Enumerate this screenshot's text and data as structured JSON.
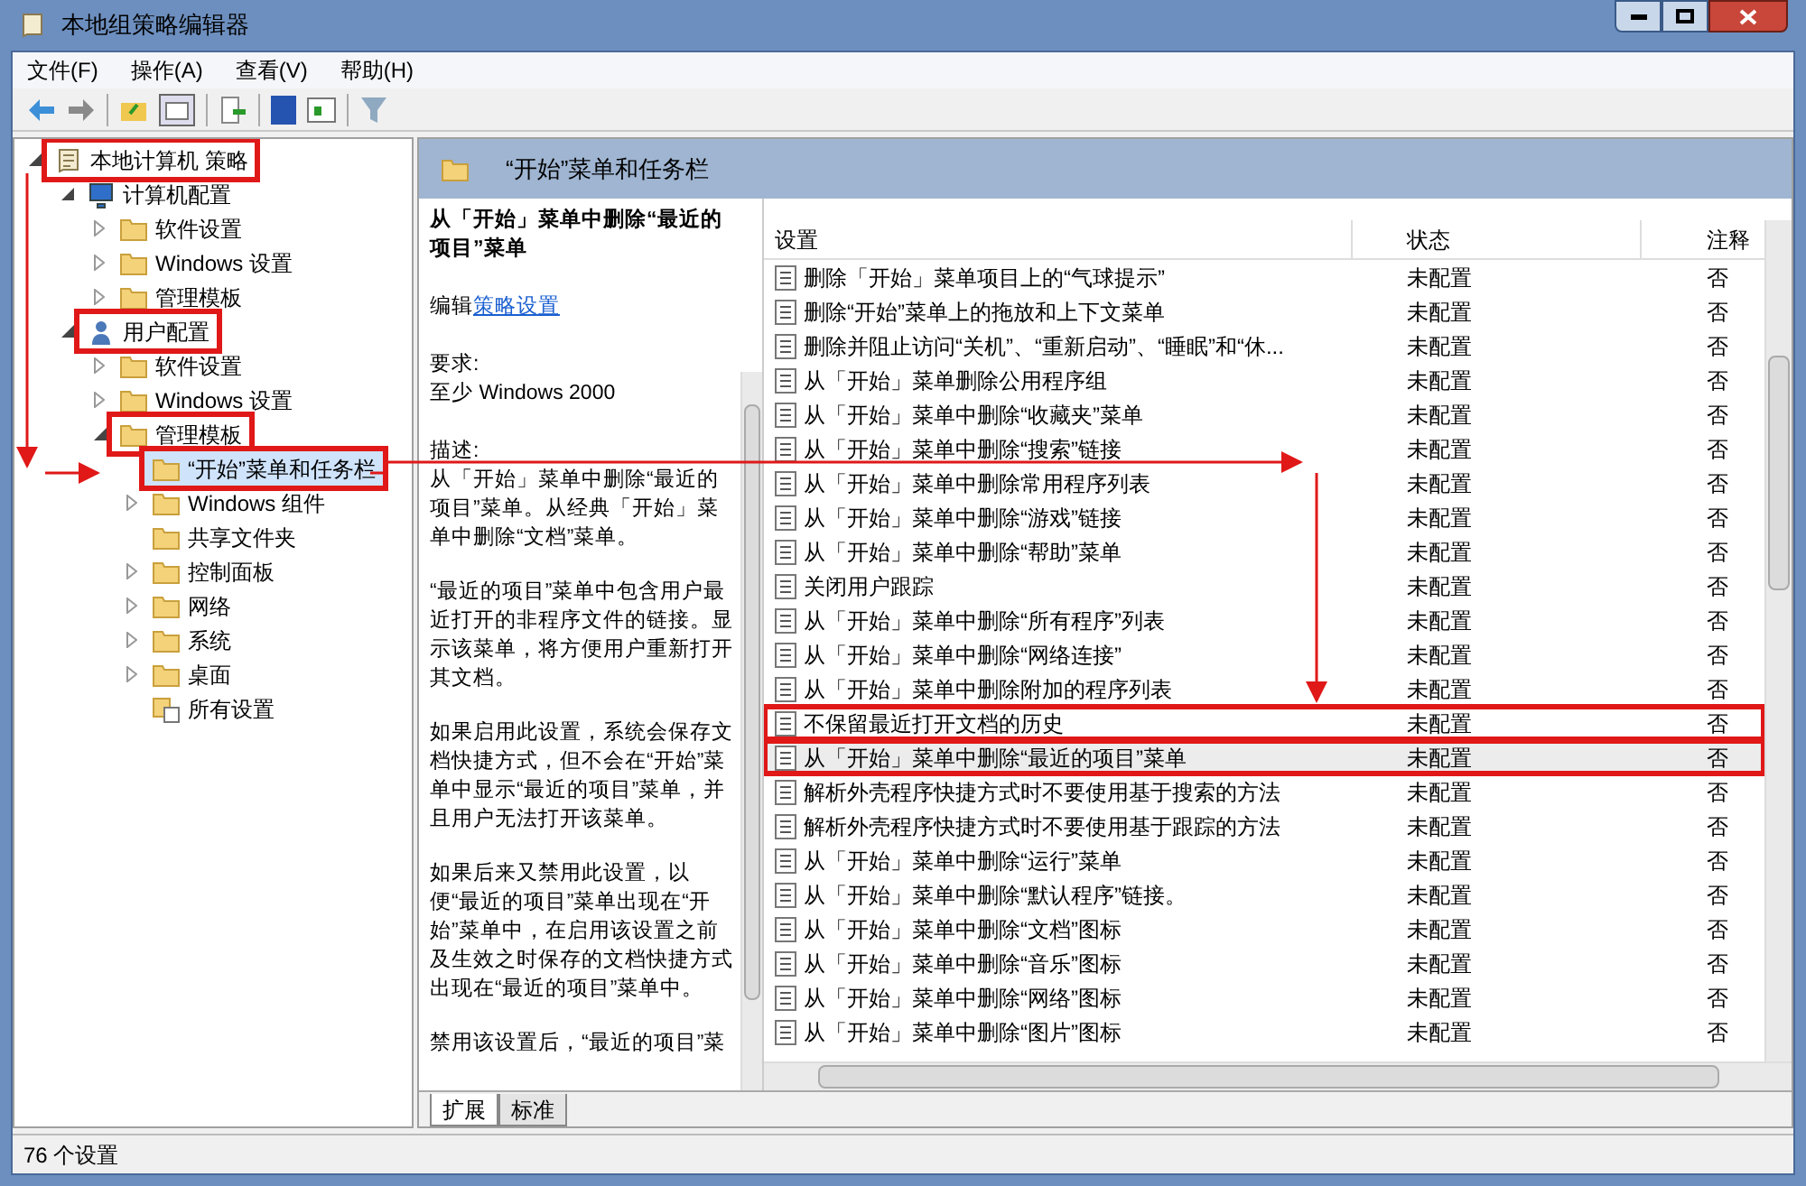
{
  "window": {
    "title": "本地组策略编辑器"
  },
  "menu": [
    "文件(F)",
    "操作(A)",
    "查看(V)",
    "帮助(H)"
  ],
  "tree": [
    {
      "label": "本地计算机 策略",
      "kind": "policy",
      "highlighted": true,
      "selected": false,
      "expanded": true,
      "children": [
        {
          "label": "计算机配置",
          "kind": "computer",
          "highlighted": false,
          "selected": false,
          "expanded": true,
          "children": [
            {
              "label": "软件设置",
              "kind": "folder",
              "highlighted": false,
              "selected": false,
              "expanded": false
            },
            {
              "label": "Windows 设置",
              "kind": "folder",
              "highlighted": false,
              "selected": false,
              "expanded": false
            },
            {
              "label": "管理模板",
              "kind": "folder",
              "highlighted": false,
              "selected": false,
              "expanded": false
            }
          ]
        },
        {
          "label": "用户配置",
          "kind": "user",
          "highlighted": true,
          "selected": false,
          "expanded": true,
          "children": [
            {
              "label": "软件设置",
              "kind": "folder",
              "highlighted": false,
              "selected": false,
              "expanded": false
            },
            {
              "label": "Windows 设置",
              "kind": "folder",
              "highlighted": false,
              "selected": false,
              "expanded": false
            },
            {
              "label": "管理模板",
              "kind": "folder",
              "highlighted": true,
              "selected": false,
              "expanded": true,
              "children": [
                {
                  "label": "“开始”菜单和任务栏",
                  "kind": "folder",
                  "highlighted": true,
                  "selected": true
                },
                {
                  "label": "Windows 组件",
                  "kind": "folder",
                  "highlighted": false,
                  "selected": false,
                  "expanded": false
                },
                {
                  "label": "共享文件夹",
                  "kind": "folder",
                  "highlighted": false,
                  "selected": false
                },
                {
                  "label": "控制面板",
                  "kind": "folder",
                  "highlighted": false,
                  "selected": false,
                  "expanded": false
                },
                {
                  "label": "网络",
                  "kind": "folder",
                  "highlighted": false,
                  "selected": false,
                  "expanded": false
                },
                {
                  "label": "系统",
                  "kind": "folder",
                  "highlighted": false,
                  "selected": false,
                  "expanded": false
                },
                {
                  "label": "桌面",
                  "kind": "folder",
                  "highlighted": false,
                  "selected": false,
                  "expanded": false
                },
                {
                  "label": "所有设置",
                  "kind": "all-settings",
                  "highlighted": false,
                  "selected": false
                }
              ]
            }
          ]
        }
      ]
    }
  ],
  "header": {
    "title": "“开始”菜单和任务栏"
  },
  "description": {
    "title": "从「开始」菜单中删除“最近的项目”菜单",
    "edit_prefix": "编辑",
    "edit_link": "策略设置",
    "requirement_label": "要求:",
    "requirement": "至少 Windows 2000",
    "description_label": "描述:",
    "paragraphs": [
      "从「开始」菜单中删除“最近的项目”菜单。从经典「开始」菜单中删除“文档”菜单。",
      "“最近的项目”菜单中包含用户最近打开的非程序文件的链接。显示该菜单，将方便用户重新打开其文档。",
      "如果启用此设置，系统会保存文档快捷方式，但不会在“开始”菜单中显示“最近的项目”菜单，并且用户无法打开该菜单。",
      "如果后来又禁用此设置，以便“最近的项目”菜单出现在“开始”菜单中，在启用该设置之前及生效之时保存的文档快捷方式出现在“最近的项目”菜单中。",
      "禁用该设置后，“最近的项目”菜"
    ]
  },
  "tabs": [
    {
      "label": "扩展",
      "selected": true
    },
    {
      "label": "标准",
      "selected": false
    }
  ],
  "table": {
    "columns": [
      "设置",
      "状态",
      "注释"
    ],
    "rows": [
      {
        "name": "删除「开始」菜单项目上的“气球提示”",
        "state": "未配置",
        "comment": "否",
        "selected": false,
        "highlighted": false
      },
      {
        "name": "删除“开始”菜单上的拖放和上下文菜单",
        "state": "未配置",
        "comment": "否",
        "selected": false,
        "highlighted": false
      },
      {
        "name": "删除并阻止访问“关机”、“重新启动”、“睡眠”和“休...",
        "state": "未配置",
        "comment": "否",
        "selected": false,
        "highlighted": false
      },
      {
        "name": "从「开始」菜单删除公用程序组",
        "state": "未配置",
        "comment": "否",
        "selected": false,
        "highlighted": false
      },
      {
        "name": "从「开始」菜单中删除“收藏夹”菜单",
        "state": "未配置",
        "comment": "否",
        "selected": false,
        "highlighted": false
      },
      {
        "name": "从「开始」菜单中删除“搜索”链接",
        "state": "未配置",
        "comment": "否",
        "selected": false,
        "highlighted": false
      },
      {
        "name": "从「开始」菜单中删除常用程序列表",
        "state": "未配置",
        "comment": "否",
        "selected": false,
        "highlighted": false
      },
      {
        "name": "从「开始」菜单中删除“游戏”链接",
        "state": "未配置",
        "comment": "否",
        "selected": false,
        "highlighted": false
      },
      {
        "name": "从「开始」菜单中删除“帮助”菜单",
        "state": "未配置",
        "comment": "否",
        "selected": false,
        "highlighted": false
      },
      {
        "name": "关闭用户跟踪",
        "state": "未配置",
        "comment": "否",
        "selected": false,
        "highlighted": false
      },
      {
        "name": "从「开始」菜单中删除“所有程序”列表",
        "state": "未配置",
        "comment": "否",
        "selected": false,
        "highlighted": false
      },
      {
        "name": "从「开始」菜单中删除“网络连接”",
        "state": "未配置",
        "comment": "否",
        "selected": false,
        "highlighted": false
      },
      {
        "name": "从「开始」菜单中删除附加的程序列表",
        "state": "未配置",
        "comment": "否",
        "selected": false,
        "highlighted": false
      },
      {
        "name": "不保留最近打开文档的历史",
        "state": "未配置",
        "comment": "否",
        "selected": false,
        "highlighted": true
      },
      {
        "name": "从「开始」菜单中删除“最近的项目”菜单",
        "state": "未配置",
        "comment": "否",
        "selected": true,
        "highlighted": true
      },
      {
        "name": "解析外壳程序快捷方式时不要使用基于搜索的方法",
        "state": "未配置",
        "comment": "否",
        "selected": false,
        "highlighted": false
      },
      {
        "name": "解析外壳程序快捷方式时不要使用基于跟踪的方法",
        "state": "未配置",
        "comment": "否",
        "selected": false,
        "highlighted": false
      },
      {
        "name": "从「开始」菜单中删除“运行”菜单",
        "state": "未配置",
        "comment": "否",
        "selected": false,
        "highlighted": false
      },
      {
        "name": "从「开始」菜单中删除“默认程序”链接。",
        "state": "未配置",
        "comment": "否",
        "selected": false,
        "highlighted": false
      },
      {
        "name": "从「开始」菜单中删除“文档”图标",
        "state": "未配置",
        "comment": "否",
        "selected": false,
        "highlighted": false
      },
      {
        "name": "从「开始」菜单中删除“音乐”图标",
        "state": "未配置",
        "comment": "否",
        "selected": false,
        "highlighted": false
      },
      {
        "name": "从「开始」菜单中删除“网络”图标",
        "state": "未配置",
        "comment": "否",
        "selected": false,
        "highlighted": false
      },
      {
        "name": "从「开始」菜单中删除“图片”图标",
        "state": "未配置",
        "comment": "否",
        "selected": false,
        "highlighted": false
      }
    ]
  },
  "status_bar": "76 个设置"
}
